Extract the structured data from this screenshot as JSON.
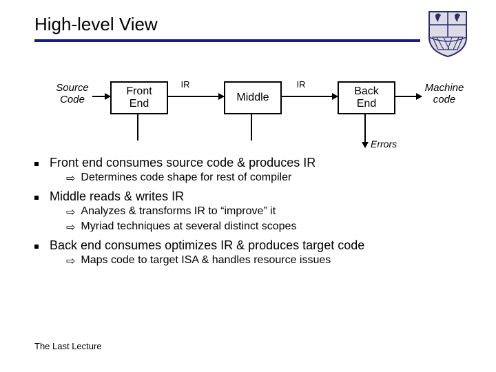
{
  "title": "High-level View",
  "diagram": {
    "source_label": "Source\nCode",
    "front_end": "Front\nEnd",
    "ir1": "IR",
    "middle": "Middle",
    "ir2": "IR",
    "back_end": "Back\nEnd",
    "machine_code": "Machine\ncode",
    "errors": "Errors"
  },
  "bullets": [
    {
      "text": "Front end consumes source code & produces IR",
      "sub": [
        "Determines code shape for rest of compiler"
      ]
    },
    {
      "text": "Middle reads & writes IR",
      "sub": [
        "Analyzes & transforms IR to “improve” it",
        "Myriad techniques at several distinct scopes"
      ]
    },
    {
      "text": "Back end consumes optimizes IR & produces target code",
      "sub": [
        "Maps code to target ISA & handles resource issues"
      ]
    }
  ],
  "footer": "The Last Lecture"
}
